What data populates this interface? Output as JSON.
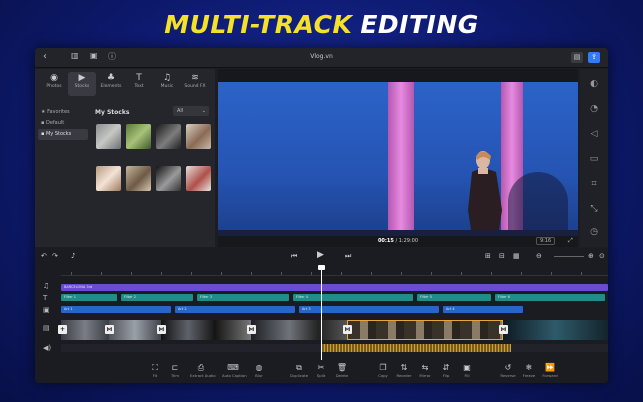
{
  "headline": {
    "part1": "MULTI-TRACK",
    "part2": "EDITING"
  },
  "app": {
    "title": "Vlog.vn"
  },
  "categories": [
    {
      "label": "Photos",
      "icon": "◉"
    },
    {
      "label": "Stocks",
      "icon": "▶"
    },
    {
      "label": "Elements",
      "icon": "♣"
    },
    {
      "label": "Text",
      "icon": "T"
    },
    {
      "label": "Music",
      "icon": "♫"
    },
    {
      "label": "Sound FX",
      "icon": "≋"
    }
  ],
  "sidebar": {
    "items": [
      "Favorites",
      "Default",
      "My Stocks"
    ]
  },
  "stocks": {
    "title": "My Stocks",
    "filter": "All"
  },
  "viewer": {
    "timecode": "00:15",
    "duration": "/ 1:29:00",
    "ratio": "9:16"
  },
  "tracks": {
    "text_label": "BARCELONA 3rd",
    "fx_labels": [
      "Filter 1",
      "Filter 2",
      "Filter 3",
      "Filter 4",
      "Filter 5",
      "Filter 6"
    ],
    "overlay_labels": [
      "Art 1",
      "Art 2",
      "Art 3",
      "Art 4"
    ]
  },
  "toolbar": {
    "tools": [
      "Fit",
      "Trim",
      "Extract Audio",
      "Auto Caption",
      "Blur",
      "Duplicate",
      "Split",
      "Delete",
      "Copy",
      "Reorder",
      "Mirror",
      "Flip",
      "Fill",
      "Reverse",
      "Freeze",
      "Forward"
    ]
  },
  "colors": {
    "accent": "#2f7cf6",
    "headline_yellow": "#f5e12a",
    "text_track": "#6a4bd1",
    "fx_track": "#1f8d8a",
    "overlay_track": "#2766c9"
  }
}
